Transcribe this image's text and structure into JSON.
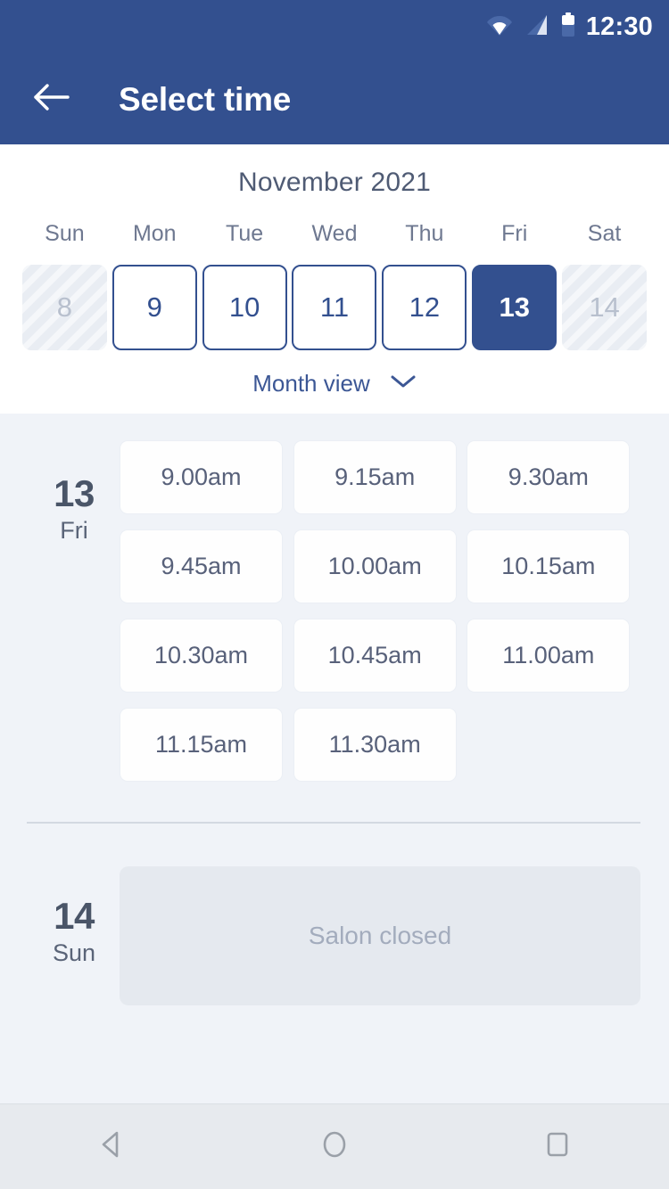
{
  "status_bar": {
    "time": "12:30",
    "icons": [
      "wifi-icon",
      "signal-icon",
      "battery-icon"
    ]
  },
  "app_bar": {
    "back_icon": "back-arrow-icon",
    "title": "Select time"
  },
  "calendar": {
    "month_label": "November 2021",
    "day_of_week_headers": [
      "Sun",
      "Mon",
      "Tue",
      "Wed",
      "Thu",
      "Fri",
      "Sat"
    ],
    "days": [
      {
        "number": "8",
        "state": "disabled"
      },
      {
        "number": "9",
        "state": "available"
      },
      {
        "number": "10",
        "state": "available"
      },
      {
        "number": "11",
        "state": "available"
      },
      {
        "number": "12",
        "state": "available"
      },
      {
        "number": "13",
        "state": "selected"
      },
      {
        "number": "14",
        "state": "disabled"
      }
    ],
    "month_view_label": "Month view",
    "month_view_icon": "chevron-down-icon"
  },
  "schedule": [
    {
      "day_number": "13",
      "day_name": "Fri",
      "closed": false,
      "slots": [
        "9.00am",
        "9.15am",
        "9.30am",
        "9.45am",
        "10.00am",
        "10.15am",
        "10.30am",
        "10.45am",
        "11.00am",
        "11.15am",
        "11.30am"
      ]
    },
    {
      "day_number": "14",
      "day_name": "Sun",
      "closed": true,
      "closed_label": "Salon closed",
      "slots": []
    }
  ],
  "nav_bar": {
    "buttons": [
      {
        "name": "back-nav-icon",
        "glyph": "triangle-left"
      },
      {
        "name": "home-nav-icon",
        "glyph": "circle"
      },
      {
        "name": "recents-nav-icon",
        "glyph": "square"
      }
    ]
  },
  "colors": {
    "brand_blue": "#33508F",
    "page_bg": "#F0F3F8",
    "card_bg": "#FEFEFE",
    "text_dark": "#4A5568",
    "text_muted": "#A3ACBD",
    "disabled_bg": "#E9EDF3",
    "closed_bg": "#E5E9EF",
    "nav_bg": "#E7EAEE"
  }
}
